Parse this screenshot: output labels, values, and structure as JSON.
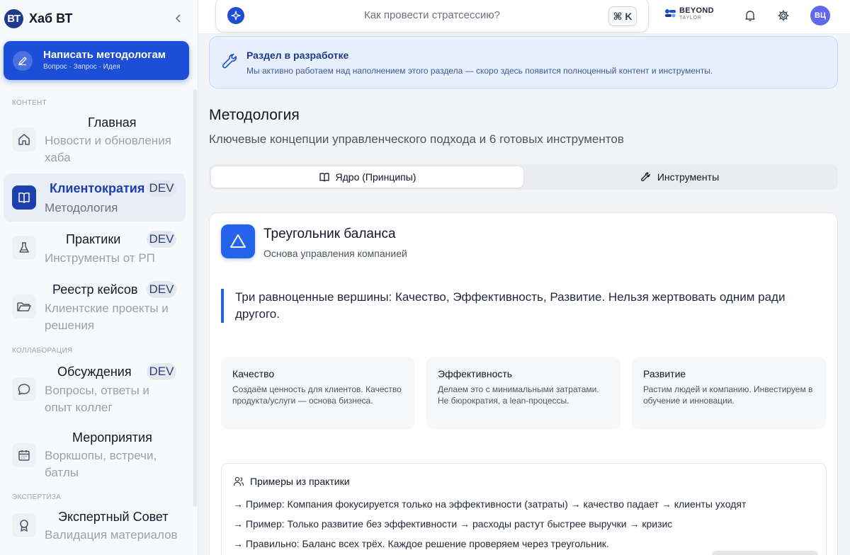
{
  "sidebar": {
    "brand_logo": "ВТ",
    "brand_name": "Хаб ВТ",
    "collapse_icon": "chevron-left-icon",
    "write": {
      "title": "Написать методологам",
      "subtitle": "Вопрос · Запрос · Идея"
    },
    "sections": {
      "content": "КОНТЕНТ",
      "collab": "КОЛЛАБОРАЦИЯ",
      "expertise": "ЭКСПЕРТИЗА"
    },
    "items": [
      {
        "title": "Главная",
        "subtitle": "Новости и обновления хаба",
        "icon": "home-icon",
        "badge": ""
      },
      {
        "title": "Клиентократия",
        "subtitle": "Методология",
        "icon": "book-icon",
        "badge": "DEV",
        "active": true
      },
      {
        "title": "Практики",
        "subtitle": "Инструменты от РП",
        "icon": "flask-icon",
        "badge": "DEV"
      },
      {
        "title": "Реестр кейсов",
        "subtitle": "Клиентские проекты и решения",
        "icon": "folder-icon",
        "badge": "DEV"
      },
      {
        "title": "Обсуждения",
        "subtitle": "Вопросы, ответы и опыт коллег",
        "icon": "chat-icon",
        "badge": "DEV"
      },
      {
        "title": "Мероприятия",
        "subtitle": "Воркшопы, встречи, батлы",
        "icon": "calendar-icon",
        "badge": ""
      },
      {
        "title": "Экспертный Совет",
        "subtitle": "Валидация материалов",
        "icon": "award-icon",
        "badge": ""
      }
    ]
  },
  "topbar": {
    "search_placeholder": "Как провести стратсессию?",
    "shortcut": "⌘ K",
    "partner_name": "BEYOND",
    "partner_tag": "TAYLOR",
    "avatar": "ВЦ"
  },
  "banner": {
    "title": "Раздел в разработке",
    "text": "Мы активно работаем над наполнением этого раздела — скоро здесь появится полноценный контент и инструменты."
  },
  "page": {
    "title": "Методология",
    "subtitle": "Ключевые концепции управленческого подхода и 6 готовых инструментов"
  },
  "tabs": [
    {
      "label": "Ядро (Принципы)",
      "icon": "book-icon",
      "active": true
    },
    {
      "label": "Инструменты",
      "icon": "wrench-icon",
      "active": false
    }
  ],
  "card": {
    "title": "Треугольник баланса",
    "subtitle": "Основа управления компанией",
    "quote": "Три равноценные вершины: Качество, Эффективность, Развитие. Нельзя жертвовать одним ради другого.",
    "pillars": [
      {
        "title": "Качество",
        "text": "Создаём ценность для клиентов. Качество продукта/услуги — основа бизнеса."
      },
      {
        "title": "Эффективность",
        "text": "Делаем это с минимальными затратами. Не бюрократия, а lean-процессы."
      },
      {
        "title": "Развитие",
        "text": "Растим людей и компанию. Инвестируем в обучение и инновации."
      }
    ],
    "examples": {
      "heading": "Примеры из практики",
      "lines": [
        "→ Пример: Компания фокусируется только на эффективности (затраты) → качество падает → клиенты уходят",
        "→ Пример: Только развитие без эффективности → расходы растут быстрее выручки → кризис",
        "→ Правильно: Баланс всех трёх. Каждое решение проверяем через треугольник."
      ]
    }
  },
  "colors": {
    "accent": "#1d4ed8",
    "active_bg": "#e9eef9",
    "banner_bg": "#e8effd"
  }
}
